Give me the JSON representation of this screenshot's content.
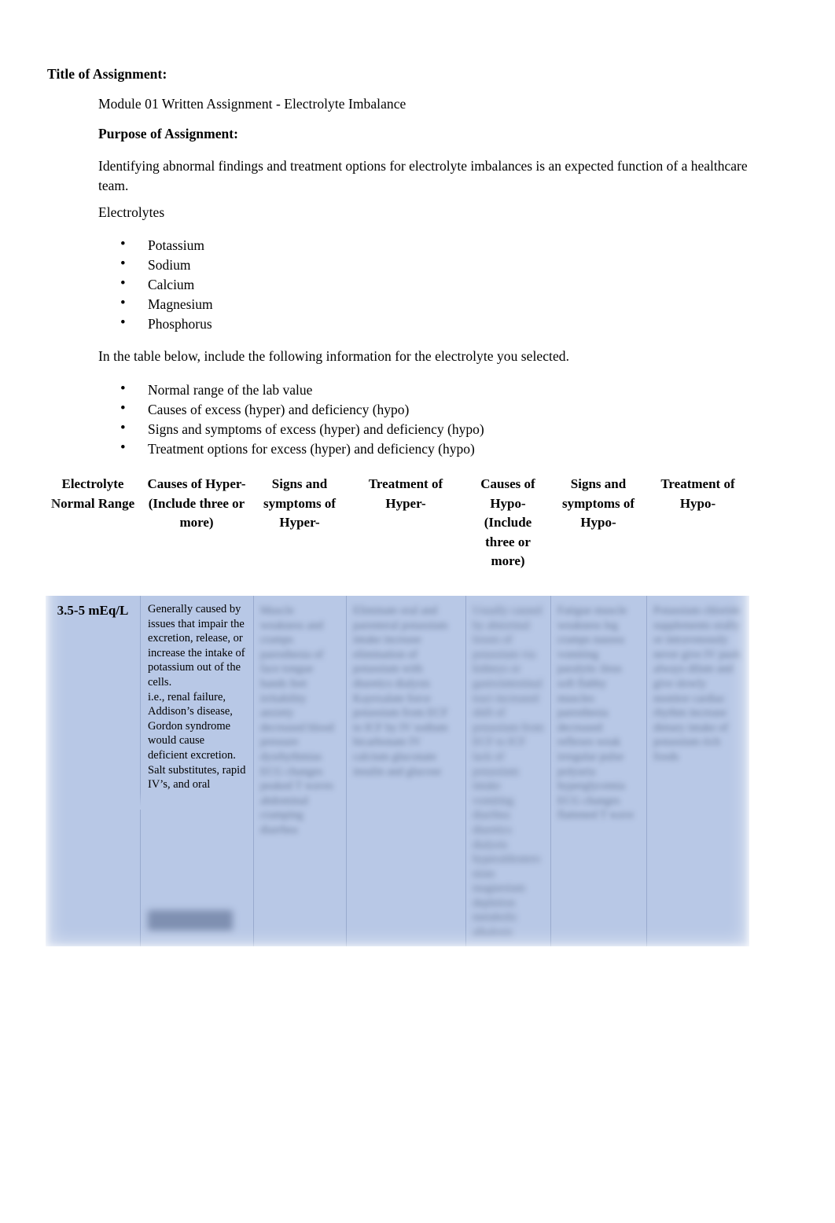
{
  "document": {
    "title_label": "Title of Assignment:",
    "assignment_name": "Module 01 Written Assignment - Electrolyte Imbalance",
    "purpose_label": "Purpose of Assignment:",
    "purpose_text": "Identifying abnormal findings and treatment options for electrolyte imbalances is an expected function of a healthcare team.",
    "electrolytes_label": "Electrolytes",
    "electrolytes_list": [
      "Potassium",
      "Sodium",
      "Calcium",
      "Magnesium",
      "Phosphorus"
    ],
    "instruction_text": "In the table below, include the following information for the electrolyte you selected.",
    "instruction_list": [
      "Normal range of the lab value",
      "Causes of excess (hyper) and deficiency (hypo)",
      "Signs and symptoms of excess (hyper) and deficiency (hypo)",
      "Treatment options for excess (hyper) and deficiency (hypo)"
    ],
    "bullet_glyph": "•"
  },
  "table": {
    "headers": [
      "Electrolyte Normal Range",
      "Causes of Hyper- (Include three or more)",
      "Signs and symptoms of Hyper-",
      "Treatment of Hyper-",
      "Causes of Hypo- (Include three or more)",
      "Signs and symptoms of Hypo-",
      "Treatment of Hypo-"
    ],
    "row": {
      "normal_range": "3.5-5 mEq/L",
      "causes_of_hyper": "Generally caused by issues that impair the excretion, release, or increase the intake of potassium out of the cells.\ni.e., renal failure, Addison’s disease, Gordon syndrome would cause deficient excretion. Salt substitutes, rapid IV’s, and oral",
      "signs_symptoms_hyper": "",
      "treatment_hyper": "",
      "causes_of_hypo": "",
      "signs_symptoms_hypo": "",
      "treatment_hypo": ""
    },
    "colors": {
      "body_fill": "#b8c8e6",
      "header_fill": "#ffffff",
      "divider": "#7d91b9"
    }
  }
}
